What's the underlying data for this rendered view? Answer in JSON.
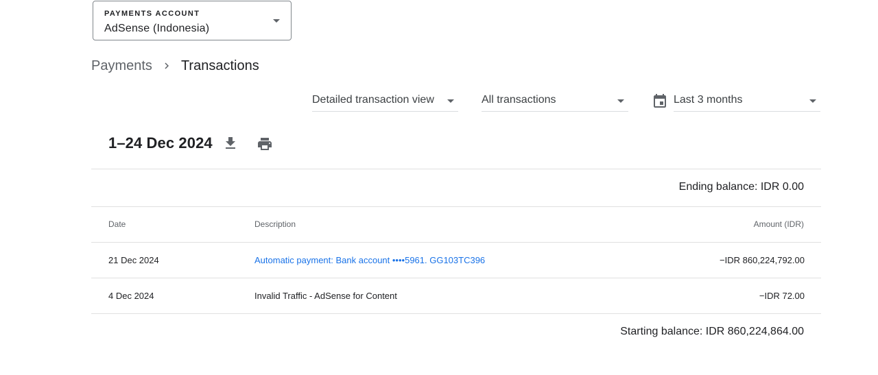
{
  "account": {
    "label": "PAYMENTS ACCOUNT",
    "value": "AdSense (Indonesia)"
  },
  "breadcrumb": {
    "parent": "Payments",
    "current": "Transactions"
  },
  "filters": {
    "view": "Detailed transaction view",
    "type": "All transactions",
    "date_range": "Last 3 months"
  },
  "period": {
    "title": "1–24 Dec 2024"
  },
  "icons": {
    "download": "download-icon",
    "print": "print-icon",
    "calendar": "calendar-icon",
    "chevron": "chevron-right-icon",
    "dropdown": "dropdown-arrow-icon"
  },
  "balances": {
    "ending": "Ending balance: IDR 0.00",
    "starting": "Starting balance: IDR 860,224,864.00"
  },
  "table": {
    "columns": {
      "date": "Date",
      "description": "Description",
      "amount": "Amount (IDR)"
    },
    "rows": [
      {
        "date": "21 Dec 2024",
        "description": "Automatic payment: Bank account ••••5961. GG103TC396",
        "amount": "−IDR 860,224,792.00",
        "is_link": true
      },
      {
        "date": "4 Dec 2024",
        "description": "Invalid Traffic - AdSense for Content",
        "amount": "−IDR 72.00",
        "is_link": false
      }
    ]
  },
  "colors": {
    "link": "#1a73e8",
    "text": "#202124",
    "muted": "#5f6368",
    "divider": "#e0e0e0"
  }
}
